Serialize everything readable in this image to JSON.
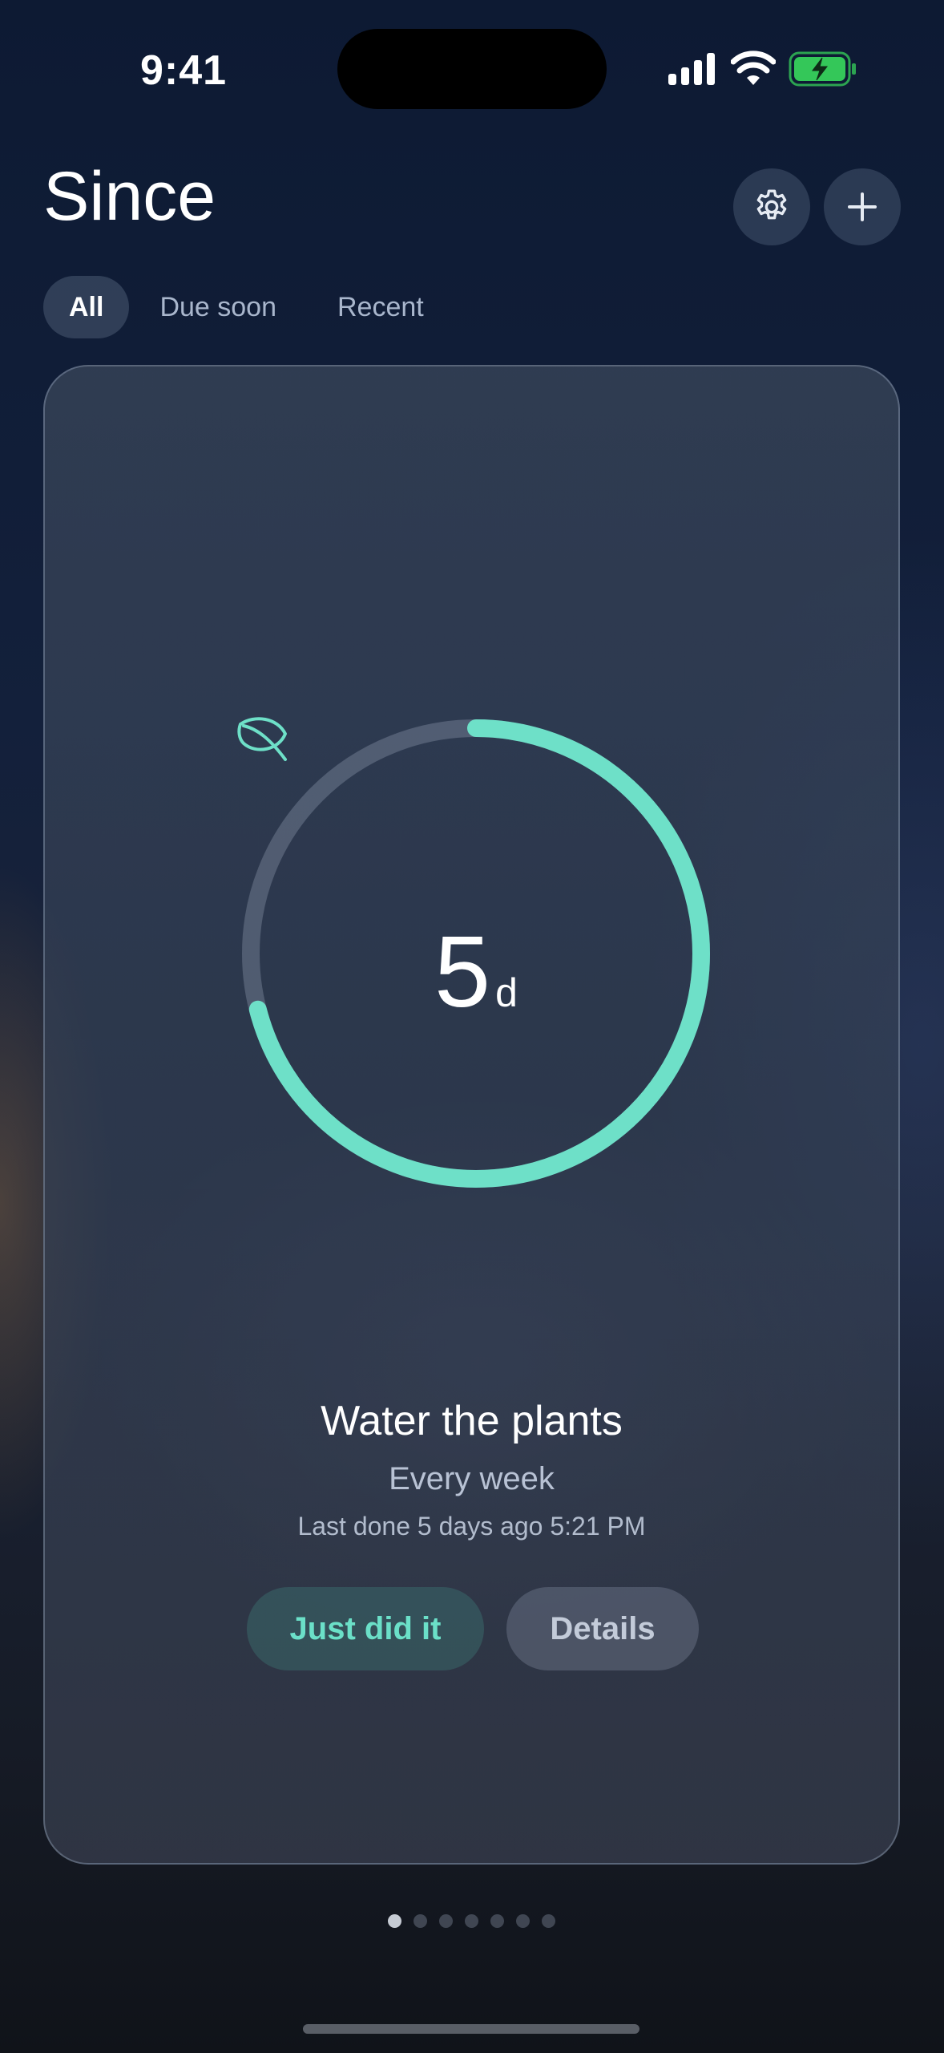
{
  "status_bar": {
    "time": "9:41",
    "icons": [
      "signal-icon",
      "wifi-icon",
      "battery-charging-icon"
    ],
    "battery_color": "#34c759"
  },
  "header": {
    "title": "Since",
    "settings_icon": "gear-icon",
    "add_icon": "plus-icon"
  },
  "tabs": [
    {
      "label": "All",
      "active": true
    },
    {
      "label": "Due soon",
      "active": false
    },
    {
      "label": "Recent",
      "active": false
    }
  ],
  "card": {
    "icon": "leaf-icon",
    "elapsed_value": "5",
    "elapsed_unit": "d",
    "progress": 0.71,
    "accent_color": "#6ee0c8",
    "title": "Water the plants",
    "frequency": "Every week",
    "last_done": "Last done 5 days ago 5:21 PM",
    "primary_action": "Just did it",
    "secondary_action": "Details"
  },
  "pagination": {
    "total": 7,
    "current": 1
  }
}
